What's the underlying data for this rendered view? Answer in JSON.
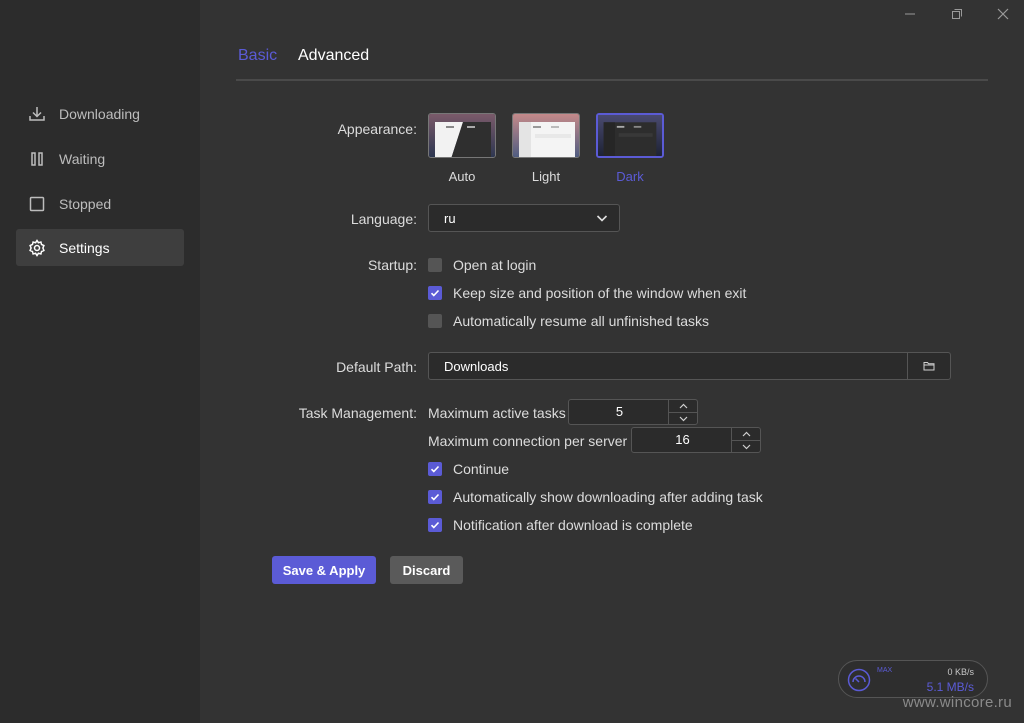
{
  "sidebar": {
    "items": [
      {
        "label": "Downloading",
        "icon": "download-icon"
      },
      {
        "label": "Waiting",
        "icon": "pause-icon"
      },
      {
        "label": "Stopped",
        "icon": "stop-icon"
      },
      {
        "label": "Settings",
        "icon": "gear-icon",
        "active": true
      }
    ]
  },
  "window": {
    "controls": [
      "minimize-icon",
      "maximize-icon",
      "close-icon"
    ]
  },
  "tabs": [
    {
      "label": "Basic",
      "active": true
    },
    {
      "label": "Advanced",
      "active": false
    }
  ],
  "appearance": {
    "label": "Appearance:",
    "options": [
      {
        "label": "Auto",
        "selected": false
      },
      {
        "label": "Light",
        "selected": false
      },
      {
        "label": "Dark",
        "selected": true
      }
    ]
  },
  "language": {
    "label": "Language:",
    "value": "ru"
  },
  "startup": {
    "label": "Startup:",
    "options": [
      {
        "label": "Open at login",
        "checked": false
      },
      {
        "label": "Keep size and position of the window when exit",
        "checked": true
      },
      {
        "label": "Automatically resume all unfinished tasks",
        "checked": false
      }
    ]
  },
  "default_path": {
    "label": "Default Path:",
    "value": "Downloads",
    "icon": "folder-icon"
  },
  "task_management": {
    "label": "Task Management:",
    "max_active_label": "Maximum active tasks",
    "max_active_value": "5",
    "max_conn_label": "Maximum connection per server",
    "max_conn_value": "16",
    "options": [
      {
        "label": "Continue",
        "checked": true
      },
      {
        "label": "Automatically show downloading after adding task",
        "checked": true
      },
      {
        "label": "Notification after download is complete",
        "checked": true
      }
    ]
  },
  "buttons": {
    "save": "Save & Apply",
    "discard": "Discard"
  },
  "speed": {
    "max_label": "MAX",
    "upload": "0 KB/s",
    "download": "5.1 MB/s"
  },
  "watermark": "www.wincore.ru",
  "colors": {
    "accent": "#5b5bd6",
    "background": "#333333",
    "sidebar": "#2c2c2c"
  }
}
